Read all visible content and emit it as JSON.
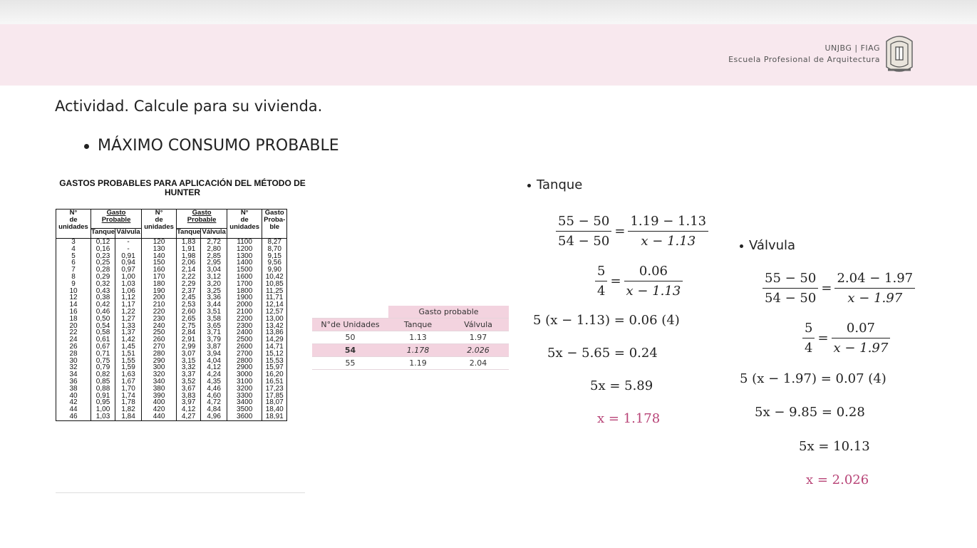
{
  "header": {
    "line1": "UNJBG | FIAG",
    "line2": "Escuela Profesional de Arquitectura"
  },
  "title": "Actividad. Calcule para su vivienda.",
  "section": "MÁXIMO CONSUMO PROBABLE",
  "hunter": {
    "title": "GASTOS PROBABLES PARA APLICACIÓN DEL MÉTODO DE HUNTER",
    "col_units": "N°\nde\nunidades",
    "col_gasto": "Gasto Probable",
    "col_tanque": "Tanque",
    "col_valvula": "Válvula",
    "col_gasto_single": "Gasto\nProba-\nble",
    "c1": "3\n4\n5\n6\n7\n8\n9\n10\n12\n14\n16\n18\n20\n22\n24\n26\n28\n30\n32\n34\n36\n38\n40\n42\n44\n46",
    "c2": "0,12\n0,16\n0,23\n0,25\n0,28\n0,29\n0,32\n0,43\n0,38\n0,42\n0,46\n0,50\n0,54\n0,58\n0,61\n0,67\n0,71\n0,75\n0,79\n0,82\n0,85\n0,88\n0,91\n0,95\n1,00\n1,03",
    "c3": "-\n-\n0,91\n0,94\n0,97\n1,00\n1,03\n1,06\n1,12\n1,17\n1,22\n1,27\n1,33\n1,37\n1,42\n1,45\n1,51\n1,55\n1,59\n1,63\n1,67\n1,70\n1,74\n1,78\n1,82\n1,84",
    "c4": "120\n130\n140\n150\n160\n170\n180\n190\n200\n210\n220\n230\n240\n250\n260\n270\n280\n290\n300\n320\n340\n380\n390\n400\n420\n440",
    "c5": "1,83\n1,91\n1,98\n2,06\n2,14\n2,22\n2,29\n2,37\n2,45\n2,53\n2,60\n2,65\n2,75\n2,84\n2,91\n2,99\n3,07\n3,15\n3,32\n3,37\n3,52\n3,67\n3,83\n3,97\n4,12\n4,27",
    "c6": "2,72\n2,80\n2,85\n2,95\n3,04\n3,12\n3,20\n3,25\n3,36\n3,44\n3,51\n3,58\n3,65\n3,71\n3,79\n3,87\n3,94\n4,04\n4,12\n4,24\n4,35\n4,46\n4,60\n4,72\n4,84\n4,96",
    "c7": "1100\n1200\n1300\n1400\n1500\n1600\n1700\n1800\n1900\n2000\n2100\n2200\n2300\n2400\n2500\n2600\n2700\n2800\n2900\n3000\n3100\n3200\n3300\n3400\n3500\n3600",
    "c8": "8,27\n8,70\n9,15\n9,56\n9,90\n10,42\n10,85\n11,25\n11,71\n12,14\n12,57\n13,00\n13,42\n13,86\n14,29\n14,71\n15,12\n15,53\n15,97\n16,20\n16,51\n17,23\n17,85\n18,07\n18,40\n18,91"
  },
  "interp": {
    "group": "Gasto probable",
    "h_units": "N°de Unidades",
    "h_tanque": "Tanque",
    "h_valvula": "Válvula",
    "r1": [
      "50",
      "1.13",
      "1.97"
    ],
    "r2": [
      "54",
      "1.178",
      "2.026"
    ],
    "r3": [
      "55",
      "1.19",
      "2.04"
    ]
  },
  "tanque": {
    "label": "Tanque",
    "f1n": "55 − 50",
    "f1d": "54 − 50",
    "f2n": "1.19 − 1.13",
    "f2d": "x − 1.13",
    "f3n": "5",
    "f3d": "4",
    "f4n": "0.06",
    "f4d": "x − 1.13",
    "l3": "5 (x − 1.13) = 0.06 (4)",
    "l4": "5x − 5.65 = 0.24",
    "l5": "5x = 5.89",
    "l6": "x = 1.178"
  },
  "valvula": {
    "label": "Válvula",
    "f1n": "55 − 50",
    "f1d": "54 − 50",
    "f2n": "2.04 − 1.97",
    "f2d": "x − 1.97",
    "f3n": "5",
    "f3d": "4",
    "f4n": "0.07",
    "f4d": "x − 1.97",
    "l3": "5 (x − 1.97) = 0.07 (4)",
    "l4": "5x − 9.85 = 0.28",
    "l5": "5x = 10.13",
    "l6": "x = 2.026"
  },
  "colors": {
    "header_bg": "#f8e8ee",
    "accent": "#b84477",
    "highlight": "#f3d3df"
  }
}
